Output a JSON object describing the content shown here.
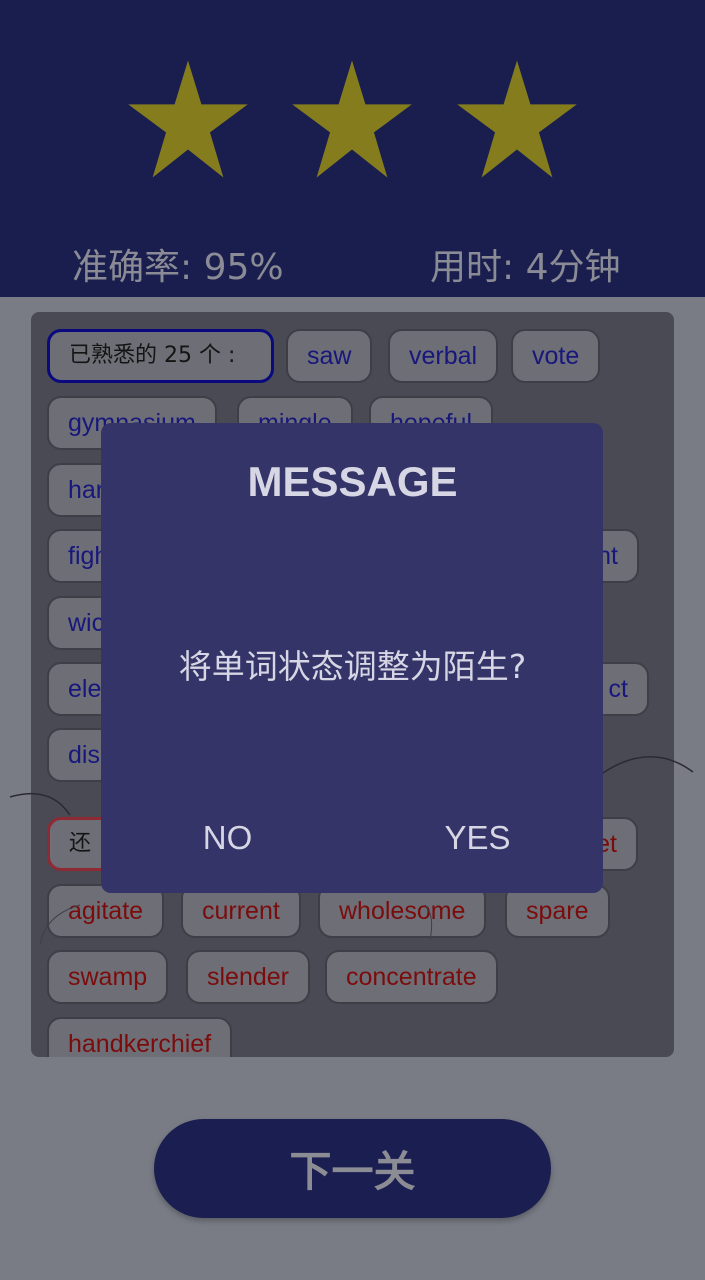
{
  "result": {
    "stars": {
      "earned": 3,
      "total": 3
    },
    "accuracy_label": "准确率: 95%",
    "time_label": "用时: 4分钟"
  },
  "colors": {
    "header_bg": "#191e4f",
    "star": "#857c1e",
    "known_word_text": "#17177c",
    "unknown_word_text": "#7b0c0c",
    "dialog_bg": "#353468"
  },
  "known_section": {
    "header": "已熟悉的 25 个 :",
    "words": [
      "saw",
      "verbal",
      "vote",
      "gymnasium",
      "mingle",
      "hopeful",
      "har",
      "figh",
      "nt",
      "wic",
      "ele",
      "ct",
      "dis"
    ]
  },
  "unknown_section": {
    "header": "还",
    "words": [
      "et",
      "agitate",
      "current",
      "wholesome",
      "spare",
      "swamp",
      "slender",
      "concentrate",
      "handkerchief"
    ]
  },
  "next_button": {
    "label": "下一关"
  },
  "dialog": {
    "title": "MESSAGE",
    "message": "将单词状态调整为陌生?",
    "no_label": "NO",
    "yes_label": "YES"
  }
}
